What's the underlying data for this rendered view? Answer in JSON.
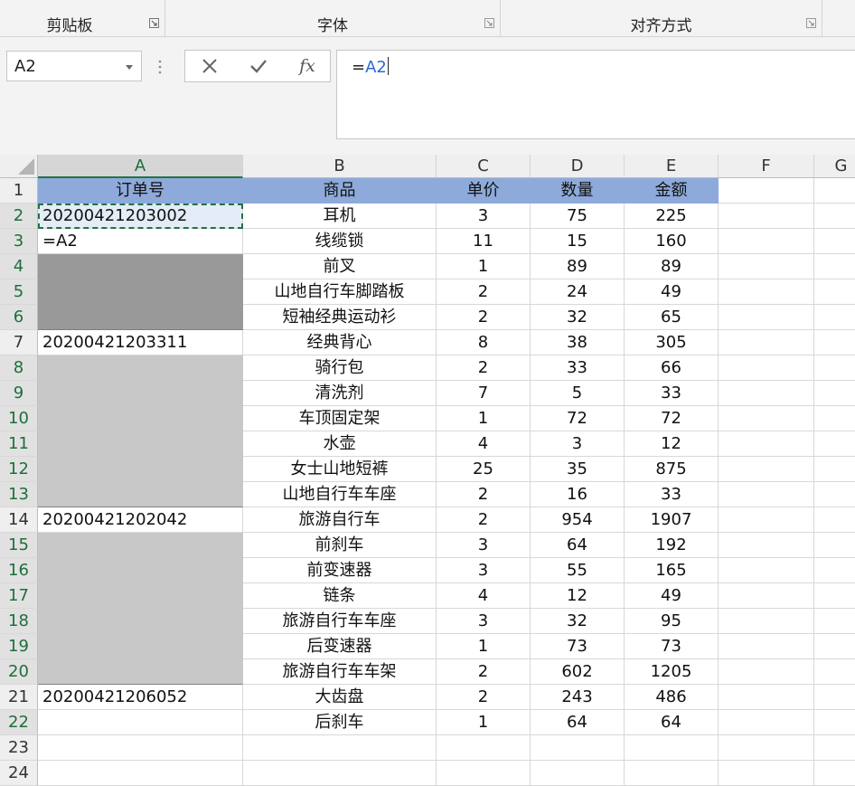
{
  "ribbon": {
    "groups": [
      {
        "label": "剪贴板"
      },
      {
        "label": "字体"
      },
      {
        "label": "对齐方式"
      }
    ]
  },
  "formula_bar": {
    "name_box": "A2",
    "prefix": "=",
    "ref": "A2",
    "cancel_icon": "close-icon",
    "enter_icon": "check-icon",
    "fx_label": "fx"
  },
  "columns": [
    "A",
    "B",
    "C",
    "D",
    "E",
    "F",
    "G"
  ],
  "rows": [
    {
      "num": "1",
      "a": "订单号",
      "b": "商品",
      "c": "单价",
      "d": "数量",
      "e": "金额"
    },
    {
      "num": "2",
      "a": "20200421203002",
      "b": "耳机",
      "c": "3",
      "d": "75",
      "e": "225"
    },
    {
      "num": "3",
      "a": "=A2",
      "b": "线缆锁",
      "c": "11",
      "d": "15",
      "e": "160"
    },
    {
      "num": "4",
      "a": "",
      "b": "前叉",
      "c": "1",
      "d": "89",
      "e": "89"
    },
    {
      "num": "5",
      "a": "",
      "b": "山地自行车脚踏板",
      "c": "2",
      "d": "24",
      "e": "49"
    },
    {
      "num": "6",
      "a": "",
      "b": "短袖经典运动衫",
      "c": "2",
      "d": "32",
      "e": "65"
    },
    {
      "num": "7",
      "a": "20200421203311",
      "b": "经典背心",
      "c": "8",
      "d": "38",
      "e": "305"
    },
    {
      "num": "8",
      "a": "",
      "b": "骑行包",
      "c": "2",
      "d": "33",
      "e": "66"
    },
    {
      "num": "9",
      "a": "",
      "b": "清洗剂",
      "c": "7",
      "d": "5",
      "e": "33"
    },
    {
      "num": "10",
      "a": "",
      "b": "车顶固定架",
      "c": "1",
      "d": "72",
      "e": "72"
    },
    {
      "num": "11",
      "a": "",
      "b": "水壶",
      "c": "4",
      "d": "3",
      "e": "12"
    },
    {
      "num": "12",
      "a": "",
      "b": "女士山地短裤",
      "c": "25",
      "d": "35",
      "e": "875"
    },
    {
      "num": "13",
      "a": "",
      "b": "山地自行车车座",
      "c": "2",
      "d": "16",
      "e": "33"
    },
    {
      "num": "14",
      "a": "20200421202042",
      "b": "旅游自行车",
      "c": "2",
      "d": "954",
      "e": "1907"
    },
    {
      "num": "15",
      "a": "",
      "b": "前刹车",
      "c": "3",
      "d": "64",
      "e": "192"
    },
    {
      "num": "16",
      "a": "",
      "b": "前变速器",
      "c": "3",
      "d": "55",
      "e": "165"
    },
    {
      "num": "17",
      "a": "",
      "b": "链条",
      "c": "4",
      "d": "12",
      "e": "49"
    },
    {
      "num": "18",
      "a": "",
      "b": "旅游自行车车座",
      "c": "3",
      "d": "32",
      "e": "95"
    },
    {
      "num": "19",
      "a": "",
      "b": "后变速器",
      "c": "1",
      "d": "73",
      "e": "73"
    },
    {
      "num": "20",
      "a": "",
      "b": "旅游自行车车架",
      "c": "2",
      "d": "602",
      "e": "1205"
    },
    {
      "num": "21",
      "a": "20200421206052",
      "b": "大齿盘",
      "c": "2",
      "d": "243",
      "e": "486"
    },
    {
      "num": "22",
      "a": "",
      "b": "后刹车",
      "c": "1",
      "d": "64",
      "e": "64"
    },
    {
      "num": "23",
      "a": "",
      "b": "",
      "c": "",
      "d": "",
      "e": ""
    },
    {
      "num": "24",
      "a": "",
      "b": "",
      "c": "",
      "d": "",
      "e": ""
    }
  ],
  "colors": {
    "header_fill": "#8eaadb",
    "selection_dark": "#999999",
    "selection_light": "#c8c8c8",
    "accent_green": "#217346",
    "formula_ref": "#2a6ad6"
  }
}
